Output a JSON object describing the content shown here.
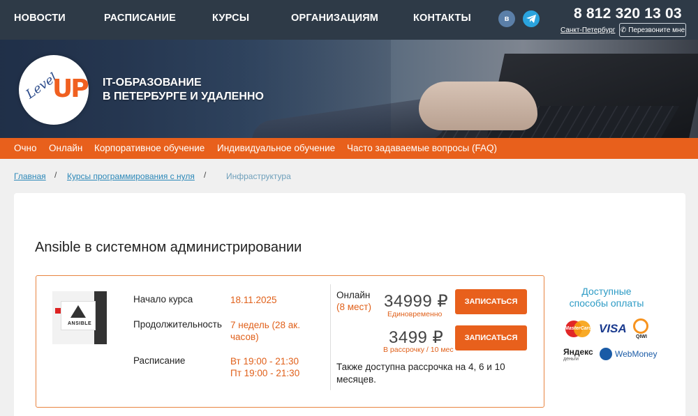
{
  "top_nav": {
    "items": [
      "НОВОСТИ",
      "РАСПИСАНИЕ",
      "КУРСЫ",
      "ОРГАНИЗАЦИЯМ",
      "КОНТАКТЫ"
    ]
  },
  "social": {
    "vk_label": "в",
    "vk_icon": "vk-icon",
    "tg_icon": "telegram-icon"
  },
  "contact": {
    "phone": "8 812 320 13 03",
    "city": "Санкт-Петербург",
    "callback_label": "Перезвоните мне",
    "callback_icon": "phone-icon"
  },
  "hero": {
    "logo_up": "UP",
    "logo_level": "Level",
    "tagline_line1": "IT-ОБРАЗОВАНИЕ",
    "tagline_line2": "В ПЕТЕРБУРГЕ И УДАЛЕННО"
  },
  "orange_menu": {
    "items": [
      "Очно",
      "Онлайн",
      "Корпоративное обучение",
      "Индивидуальное обучение",
      "Часто задаваемые вопросы (FAQ)"
    ]
  },
  "breadcrumb": {
    "home": "Главная",
    "section": "Курсы программирования с нуля",
    "current": "Инфраструктура",
    "separator": "/"
  },
  "course": {
    "title": "Ansible в системном администрировании",
    "thumb_label": "ANSIBLE",
    "start_label": "Начало курса",
    "start_value": "18.11.2025",
    "duration_label": "Продолжительность",
    "duration_value": "7 недель (28 ак. часов)",
    "schedule_label": "Расписание",
    "schedule_line1": "Вт 19:00 - 21:30",
    "schedule_line2": "Пт 19:00 - 21:30",
    "format": "Онлайн",
    "format_sub": "(8 мест)",
    "price_full": "34999 ₽",
    "price_full_sub": "Единовременно",
    "price_install": "3499 ₽",
    "price_install_sub": "В рассрочку / 10 мес",
    "enroll_label": "ЗАПИСАТЬСЯ",
    "note": "Также доступна рассрочка на 4, 6 и 10 месяцев."
  },
  "payment": {
    "title": "Доступные способы оплаты",
    "mastercard": "MasterCard",
    "visa": "VISA",
    "qiwi": "QIWI",
    "yandex": "Яндекс",
    "yandex_sub": "деньги",
    "webmoney": "WebMoney"
  },
  "colors": {
    "accent": "#e8601c",
    "topbar": "#2e3a47",
    "link": "#2c88b8"
  }
}
